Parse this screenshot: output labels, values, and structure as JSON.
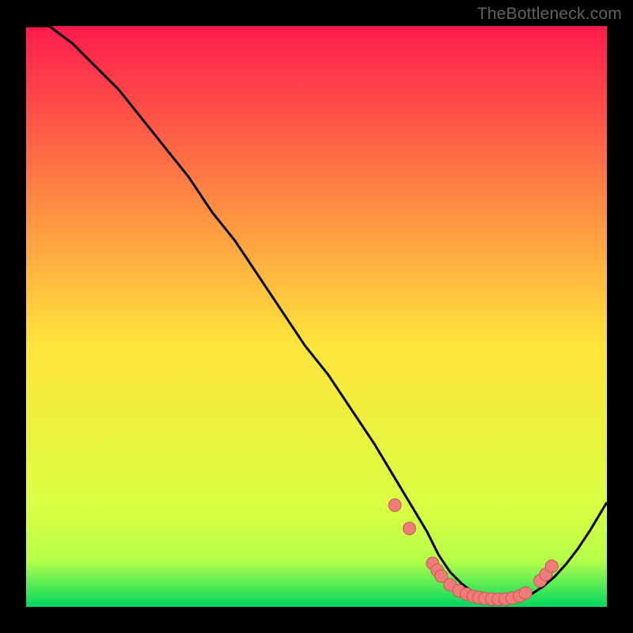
{
  "watermark": "TheBottleneck.com",
  "colors": {
    "bg_black": "#000000",
    "curve": "#000000",
    "marker_fill": "#ef7c78",
    "marker_stroke": "#c55a56",
    "grad_top": "#ff1a4d",
    "grad_mid": "#ffe53b",
    "grad_low1": "#d9ff42",
    "grad_low2": "#b6ff49",
    "grad_bottom": "#00d860"
  },
  "chart_data": {
    "type": "line",
    "title": "",
    "xlabel": "",
    "ylabel": "",
    "xlim": [
      0,
      100
    ],
    "ylim": [
      0,
      100
    ],
    "grid": false,
    "annotations": [
      "TheBottleneck.com"
    ],
    "curve": {
      "name": "bottleneck_curve",
      "x": [
        0,
        4,
        8,
        12,
        16,
        20,
        24,
        28,
        32,
        36,
        40,
        44,
        48,
        52,
        56,
        60,
        63,
        66,
        69,
        71,
        73,
        75,
        77,
        79,
        81,
        83,
        85,
        87,
        89,
        91,
        93,
        95,
        97,
        100
      ],
      "y": [
        100,
        100,
        97,
        93,
        89,
        84,
        79,
        74,
        68,
        63,
        57,
        51,
        45,
        40,
        34,
        28,
        23,
        18,
        13,
        9,
        6,
        4,
        2.5,
        1.8,
        1.4,
        1.3,
        1.5,
        2.2,
        3.5,
        5.2,
        7.4,
        10,
        13,
        18
      ]
    },
    "markers": {
      "name": "highlighted_points",
      "points": [
        {
          "x": 63.5,
          "y": 17.5
        },
        {
          "x": 66,
          "y": 13.5
        },
        {
          "x": 70,
          "y": 7.5
        },
        {
          "x": 70.8,
          "y": 6.3
        },
        {
          "x": 71.5,
          "y": 5.3
        },
        {
          "x": 73,
          "y": 3.8
        },
        {
          "x": 74.5,
          "y": 2.8
        },
        {
          "x": 75.8,
          "y": 2.2
        },
        {
          "x": 77,
          "y": 1.8
        },
        {
          "x": 78,
          "y": 1.6
        },
        {
          "x": 79,
          "y": 1.45
        },
        {
          "x": 80.2,
          "y": 1.35
        },
        {
          "x": 81.3,
          "y": 1.3
        },
        {
          "x": 82.5,
          "y": 1.35
        },
        {
          "x": 83.7,
          "y": 1.5
        },
        {
          "x": 85,
          "y": 1.9
        },
        {
          "x": 86,
          "y": 2.4
        },
        {
          "x": 88.5,
          "y": 4.5
        },
        {
          "x": 89.5,
          "y": 5.6
        },
        {
          "x": 90.5,
          "y": 7.0
        }
      ]
    }
  }
}
